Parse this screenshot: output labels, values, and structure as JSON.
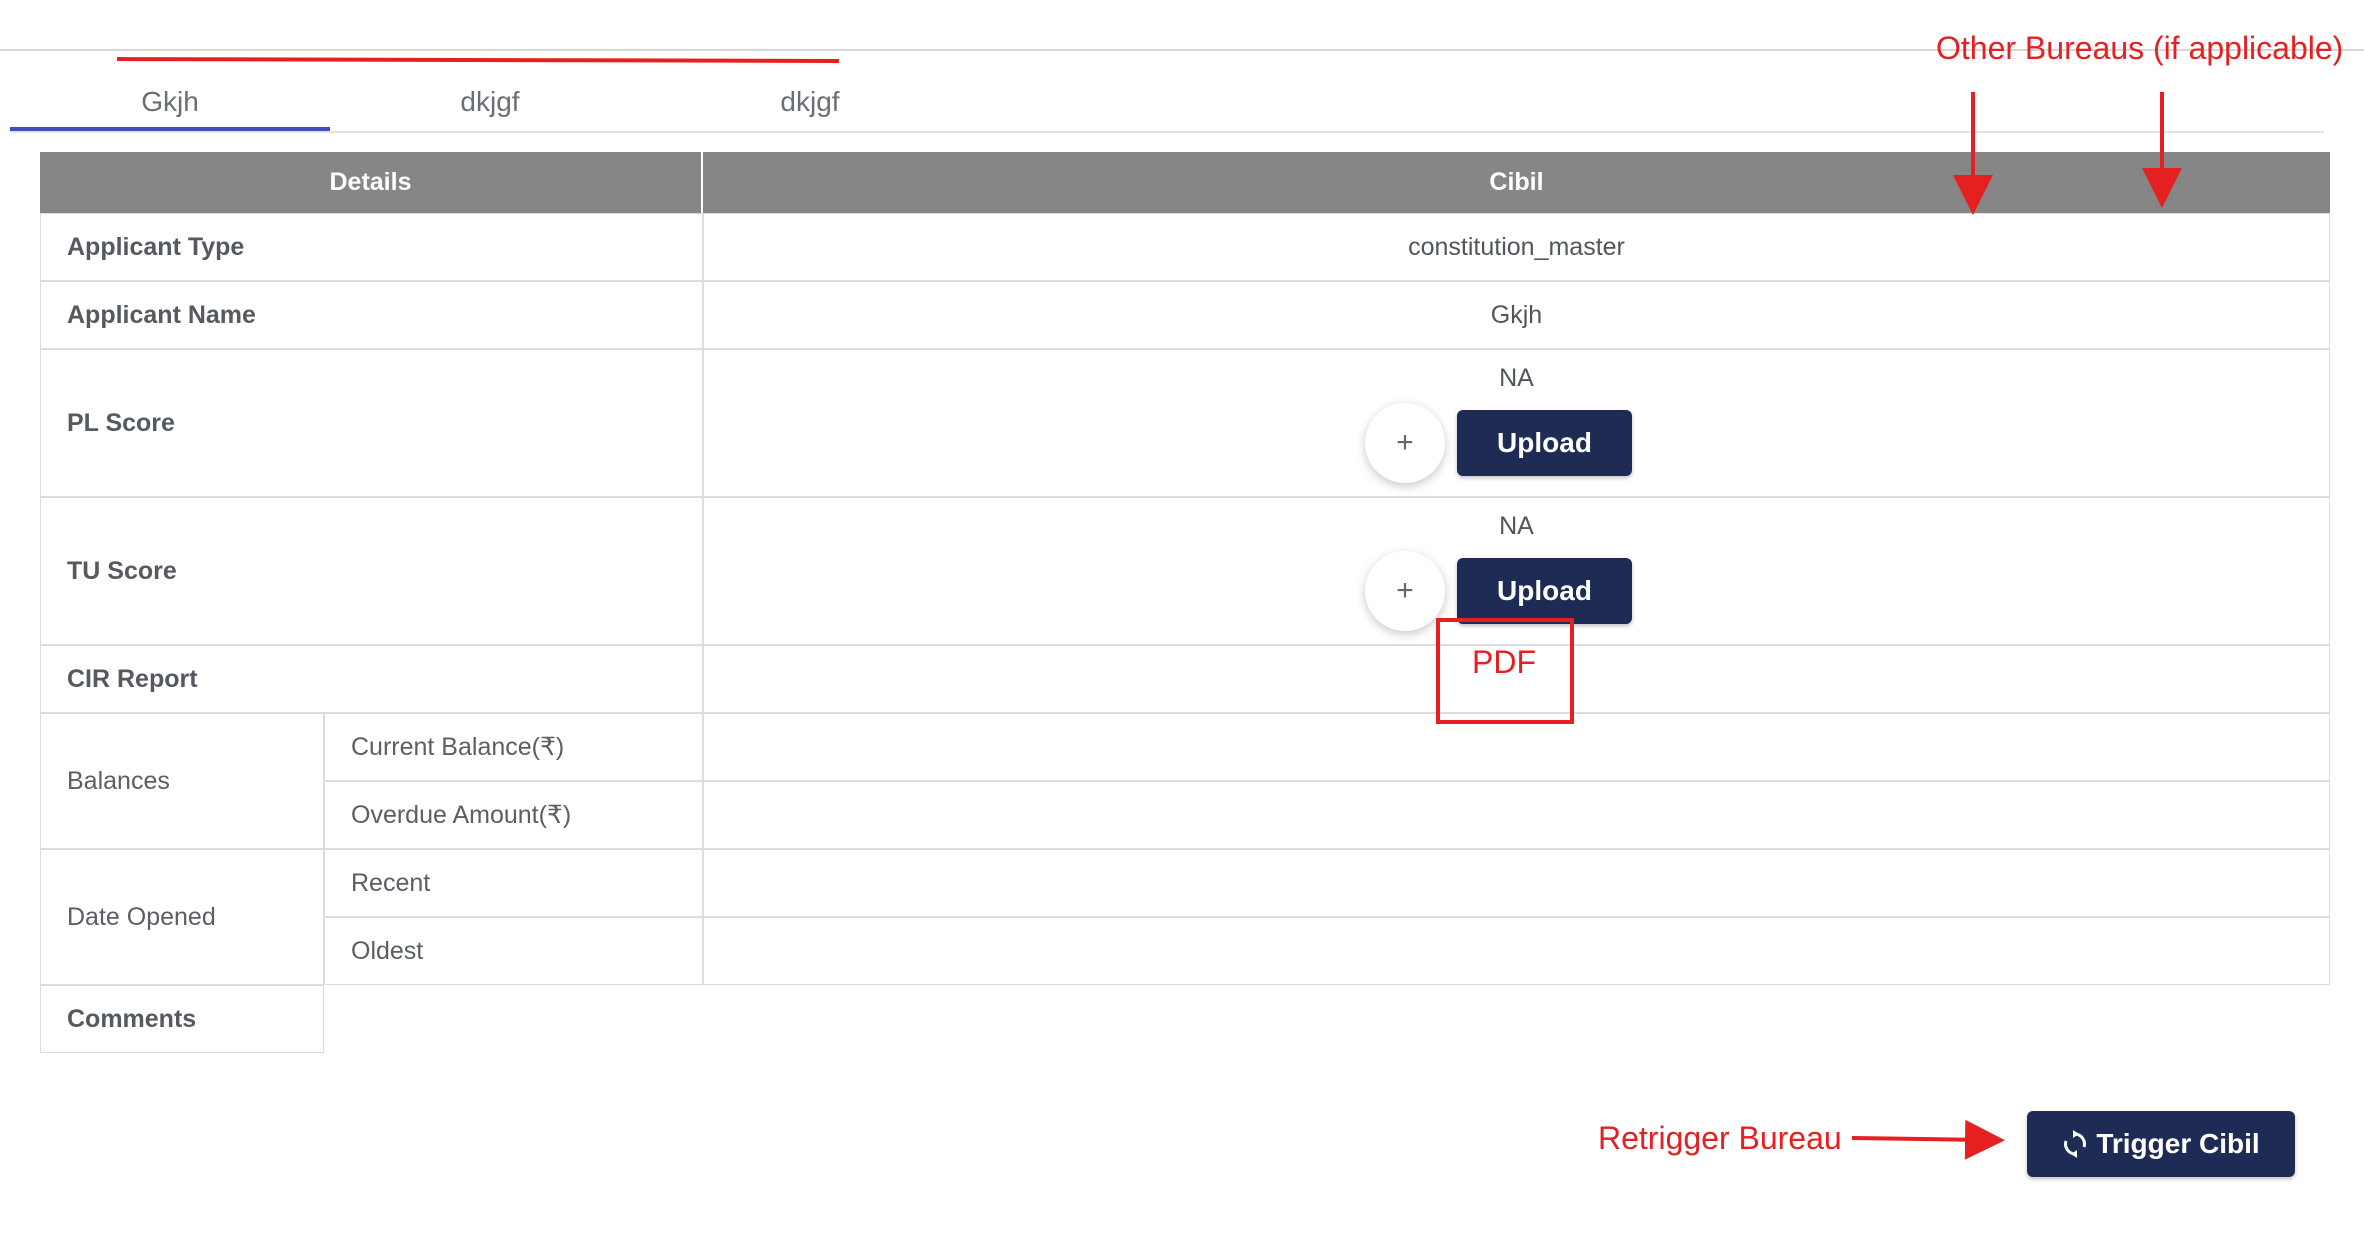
{
  "tabs": [
    {
      "label": "Gkjh",
      "active": true
    },
    {
      "label": "dkjgf",
      "active": false
    },
    {
      "label": "dkjgf",
      "active": false
    }
  ],
  "table": {
    "headers": {
      "details": "Details",
      "bureau": "Cibil"
    },
    "rows": {
      "applicant_type": {
        "label": "Applicant Type",
        "value": "constitution_master"
      },
      "applicant_name": {
        "label": "Applicant Name",
        "value": "Gkjh"
      },
      "pl_score": {
        "label": "PL Score",
        "value": "NA",
        "upload_label": "Upload",
        "add_label": "+"
      },
      "tu_score": {
        "label": "TU Score",
        "value": "NA",
        "upload_label": "Upload",
        "add_label": "+"
      },
      "cir_report": {
        "label": "CIR Report"
      },
      "balances": {
        "label": "Balances",
        "current": "Current Balance(₹)",
        "overdue": "Overdue Amount(₹)"
      },
      "date_opened": {
        "label": "Date Opened",
        "recent": "Recent",
        "oldest": "Oldest"
      },
      "comments": {
        "label": "Comments"
      }
    }
  },
  "actions": {
    "trigger_label": "Trigger Cibil"
  },
  "annotations": {
    "other_bureaus": "Other Bureaus (if applicable)",
    "pdf": "PDF",
    "retrigger": "Retrigger Bureau"
  },
  "colors": {
    "header_bg": "#868686",
    "button_bg": "#1e2c55",
    "tab_active": "#3b4fbf",
    "annotation": "#e52020"
  }
}
